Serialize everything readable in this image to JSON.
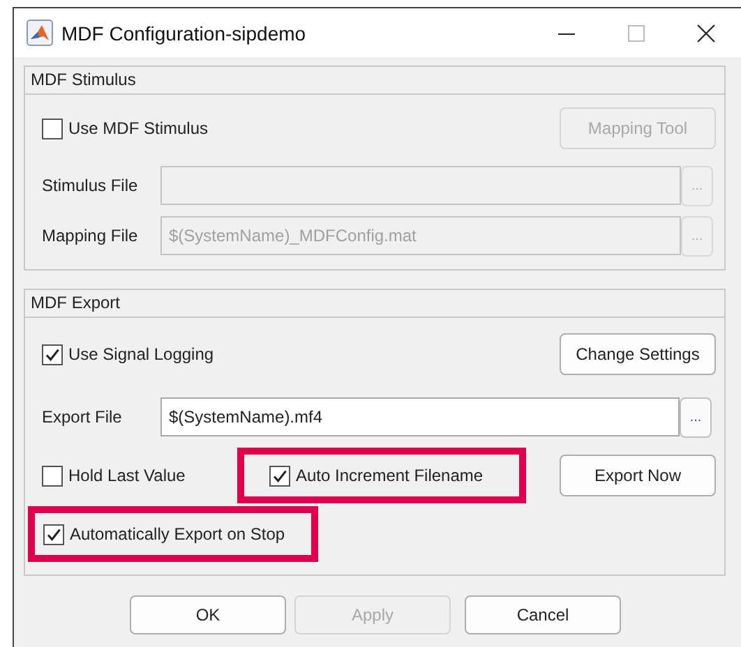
{
  "window": {
    "title": "MDF Configuration-sipdemo"
  },
  "stimulus_panel": {
    "title": "MDF Stimulus",
    "use_checkbox": {
      "label": "Use MDF Stimulus",
      "checked": false,
      "highlighted": false
    },
    "mapping_tool_button": {
      "label": "Mapping Tool",
      "disabled": true
    },
    "fields": [
      {
        "label": "Stimulus File",
        "disabled": true,
        "browse_label": "..."
      },
      {
        "label": "Mapping File",
        "value": "$(SystemName)_MDFConfig.mat",
        "disabled": true,
        "browse_label": "..."
      }
    ]
  },
  "export_panel": {
    "title": "MDF Export",
    "signal_logging_checkbox": {
      "label": "Use Signal Logging",
      "checked": true,
      "highlighted": false
    },
    "change_settings_button": {
      "label": "Change Settings",
      "disabled": false
    },
    "export_file": {
      "label": "Export File",
      "value": "$(SystemName).mf4",
      "disabled": false,
      "browse_label": "..."
    },
    "hold_last_checkbox": {
      "label": "Hold Last Value",
      "checked": false,
      "highlighted": false
    },
    "auto_increment_checkbox": {
      "label": "Auto Increment Filename",
      "checked": true,
      "highlighted": true
    },
    "export_now_button": {
      "label": "Export Now",
      "disabled": false
    },
    "auto_export_checkbox": {
      "label": "Automatically Export on Stop",
      "checked": true,
      "highlighted": true
    }
  },
  "buttons": [
    {
      "label": "OK",
      "disabled": false
    },
    {
      "label": "Apply",
      "disabled": true
    },
    {
      "label": "Cancel",
      "disabled": false
    }
  ]
}
